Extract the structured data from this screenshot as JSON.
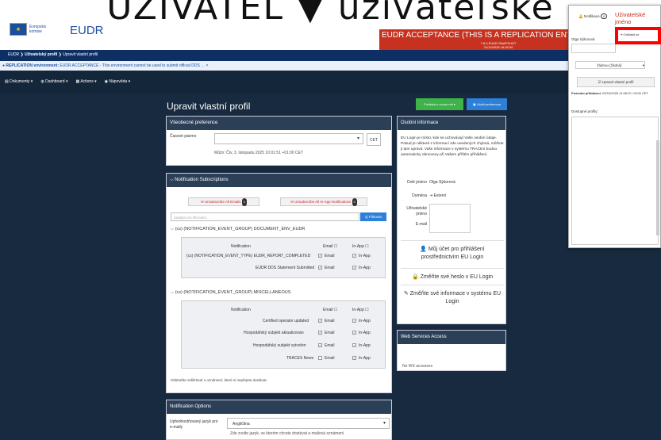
{
  "overlay": {
    "text": "UŽIVATEL ▼ užívateľské"
  },
  "header": {
    "logo_line1": "Evropská",
    "logo_line2": "komise",
    "app_name": "EUDR",
    "env_banner": "EUDR ACCEPTANCE (THIS IS A REPLICATION ENVIRONMENT. DO NOT",
    "env_version": "7.8.0 EUDR-SNAPSHOT",
    "env_date": "21/10/2025 16:25:00"
  },
  "breadcrumb": {
    "root": "EUDR",
    "profile": "Uživatelský profil",
    "current": "Upravit vlastní profil"
  },
  "replication": {
    "label": "REPLICATION environment:",
    "text": "EUDR ACCEPTANCE - This environment cannot be used to submit official DDS"
  },
  "menu": {
    "documents": "Dokumenty",
    "dashboard": "Dashboard",
    "actions": "Actions",
    "help": "Nápověda"
  },
  "page": {
    "title": "Upravit vlastní profil",
    "request_role": "Požádat o novou roli",
    "save_prefs": "Uložit preference"
  },
  "general": {
    "header": "Všeobecné preference",
    "tz_label": "Časové pásmo",
    "tz_unit": "CET",
    "now_text": "Můžn: Čtv, 3. listopadu 2025 10:01:51 +01:00 CET"
  },
  "subs": {
    "header": "Notification Subscriptions",
    "unsub_email": "Unsubscribe All Emails",
    "unsub_email_count": "0",
    "unsub_inapp": "Unsubscribe All In-App Notifications",
    "unsub_inapp_count": "0",
    "search_placeholder": "Zadejte pro filtrování...",
    "filter_btn": "Q Filtrovat",
    "col_notification": "Notification",
    "col_email": "Email",
    "col_inapp": "In-App",
    "group1": "(cs) (NOTIFICATION_EVENT_GROUP) DOCUMENT_ENV_EUDR",
    "group1_rows": [
      {
        "name": "(cs) (NOTIFICATION_EVENT_TYPE) EUDR_REPORT_COMPLETED",
        "email": "Email",
        "inapp": "In-App"
      },
      {
        "name": "EUDR DDS Statement Submitted",
        "email": "Email",
        "inapp": "In-App"
      }
    ],
    "group2": "(cs) (NOTIFICATION_EVENT_GROUP) MISCELLANEOUS",
    "group2_rows": [
      {
        "name": "Certified operator updated",
        "email": "Email",
        "inapp": "In-App"
      },
      {
        "name": "Hospodářský subjekt aktualizován",
        "email": "Email",
        "inapp": "In-App"
      },
      {
        "name": "Hospodářský subjekt vytvořen",
        "email": "Email",
        "inapp": "In-App"
      },
      {
        "name": "TRACES News",
        "email": "Email",
        "inapp": "In-App"
      }
    ],
    "note": "Odstraňte zaškrtnutí u oznámení, které si nepřejete dostávat."
  },
  "options": {
    "header": "Notification Options",
    "lang_label": "Upřednostňovaný jazyk pro e-maily",
    "lang_value": "Angličtina",
    "lang_hint": "Zde zvolte jazyk, ve kterém chcete dostávat e-mailová oznámení"
  },
  "personal": {
    "header": "Osobní informace",
    "text": "EU Login je místo, kde se uchovávají Vaše osobní údaje. Pokud je některá z informací zde uvedených chybná, můžete ji tam upravit. Vaše informace v systému TRACES budou automaticky obnoveny při Vašem příštím přihlášení.",
    "full_name_label": "Celé jméno",
    "full_name": "Olga Sýkorová",
    "domain_label": "Doména",
    "domain": "Externí",
    "username_label": "Uživatelské jméno",
    "email_label": "E-mail",
    "link_account": "Můj účet pro přihlášení prostřednictvím EU Login",
    "link_password": "Změňte své heslo v EU Login",
    "link_info": "Změňte své informace v systému EU Login"
  },
  "ws": {
    "header": "Web Services Access",
    "empty": "No WS accesses"
  },
  "dropdown": {
    "notifications": "Notifikace",
    "notif_count": "0",
    "username_tab": "Uživatelské jméno",
    "user_name": "Olga Sýkorová",
    "logout": "Odhlásit se",
    "role_select": "žádnou (žádná)",
    "edit_profile": "Upravit vlastní profil",
    "last_login_label": "Poslední přihlášení:",
    "last_login": "03/10/2025 11:58:20 +0100 CET",
    "profiles_label": "Dostupné profily:"
  }
}
